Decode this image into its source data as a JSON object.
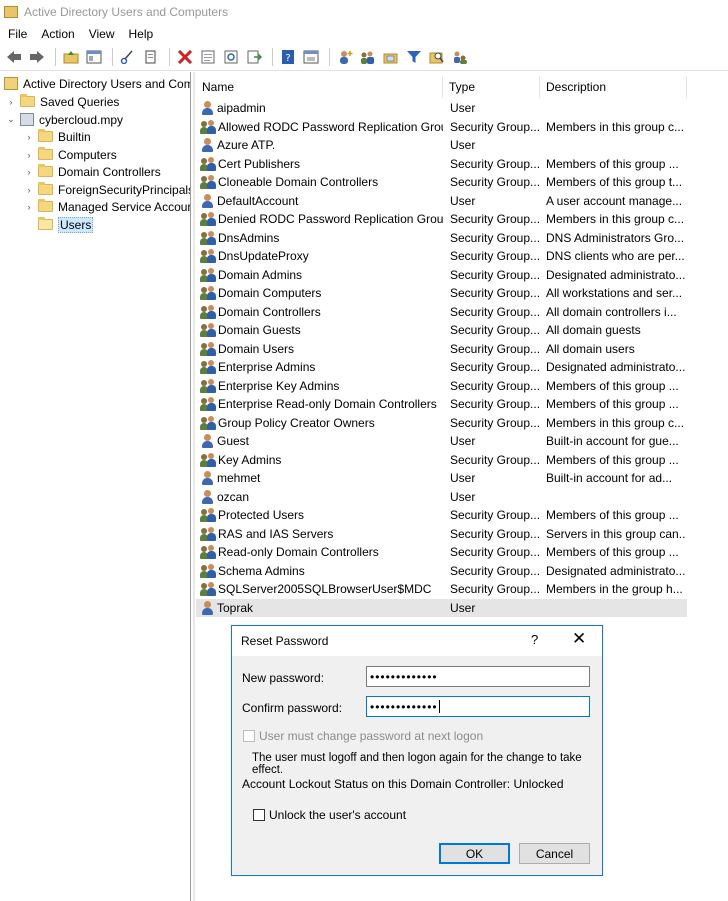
{
  "window": {
    "title": "Active Directory Users and Computers"
  },
  "menu": [
    "File",
    "Action",
    "View",
    "Help"
  ],
  "toolbar": {
    "icons": [
      "back-icon",
      "forward-icon",
      "up-folder-icon",
      "show-hide-tree-icon",
      "cut-icon",
      "copy-icon",
      "delete-icon",
      "properties-icon",
      "refresh-icon",
      "export-list-icon",
      "help-icon",
      "console-icon",
      "new-user-icon",
      "new-group-icon",
      "new-ou-icon",
      "filter-icon",
      "find-icon",
      "add-to-group-icon"
    ]
  },
  "tree": {
    "root": "Active Directory Users and Com",
    "saved_queries": "Saved Queries",
    "domain": "cybercloud.mpy",
    "children": [
      "Builtin",
      "Computers",
      "Domain Controllers",
      "ForeignSecurityPrincipals",
      "Managed Service Accour",
      "Users"
    ],
    "selected": "Users"
  },
  "columns": {
    "name": "Name",
    "type": "Type",
    "description": "Description"
  },
  "rows": [
    {
      "name": "aipadmin",
      "type": "User",
      "description": "",
      "kind": "user"
    },
    {
      "name": "Allowed RODC Password Replication Group",
      "type": "Security Group...",
      "description": "Members in this group c...",
      "kind": "group"
    },
    {
      "name": "Azure ATP.",
      "type": "User",
      "description": "",
      "kind": "user"
    },
    {
      "name": "Cert Publishers",
      "type": "Security Group...",
      "description": "Members of this group ...",
      "kind": "group"
    },
    {
      "name": "Cloneable Domain Controllers",
      "type": "Security Group...",
      "description": "Members of this group t...",
      "kind": "group"
    },
    {
      "name": "DefaultAccount",
      "type": "User",
      "description": "A user account manage...",
      "kind": "user"
    },
    {
      "name": "Denied RODC Password Replication Group",
      "type": "Security Group...",
      "description": "Members in this group c...",
      "kind": "group"
    },
    {
      "name": "DnsAdmins",
      "type": "Security Group...",
      "description": "DNS Administrators Gro...",
      "kind": "group"
    },
    {
      "name": "DnsUpdateProxy",
      "type": "Security Group...",
      "description": "DNS clients who are per...",
      "kind": "group"
    },
    {
      "name": "Domain Admins",
      "type": "Security Group...",
      "description": "Designated administrato...",
      "kind": "group"
    },
    {
      "name": "Domain Computers",
      "type": "Security Group...",
      "description": "All workstations and ser...",
      "kind": "group"
    },
    {
      "name": "Domain Controllers",
      "type": "Security Group...",
      "description": "All domain controllers i...",
      "kind": "group"
    },
    {
      "name": "Domain Guests",
      "type": "Security Group...",
      "description": "All domain guests",
      "kind": "group"
    },
    {
      "name": "Domain Users",
      "type": "Security Group...",
      "description": "All domain users",
      "kind": "group"
    },
    {
      "name": "Enterprise Admins",
      "type": "Security Group...",
      "description": "Designated administrato...",
      "kind": "group"
    },
    {
      "name": "Enterprise Key Admins",
      "type": "Security Group...",
      "description": "Members of this group ...",
      "kind": "group"
    },
    {
      "name": "Enterprise Read-only Domain Controllers",
      "type": "Security Group...",
      "description": "Members of this group ...",
      "kind": "group"
    },
    {
      "name": "Group Policy Creator Owners",
      "type": "Security Group...",
      "description": "Members in this group c...",
      "kind": "group"
    },
    {
      "name": "Guest",
      "type": "User",
      "description": "Built-in account for gue...",
      "kind": "user"
    },
    {
      "name": "Key Admins",
      "type": "Security Group...",
      "description": "Members of this group ...",
      "kind": "group"
    },
    {
      "name": "mehmet",
      "type": "User",
      "description": "Built-in account for ad...",
      "kind": "user"
    },
    {
      "name": "ozcan",
      "type": "User",
      "description": "",
      "kind": "user"
    },
    {
      "name": "Protected Users",
      "type": "Security Group...",
      "description": "Members of this group ...",
      "kind": "group"
    },
    {
      "name": "RAS and IAS Servers",
      "type": "Security Group...",
      "description": "Servers in this group can...",
      "kind": "group"
    },
    {
      "name": "Read-only Domain Controllers",
      "type": "Security Group...",
      "description": "Members of this group ...",
      "kind": "group"
    },
    {
      "name": "Schema Admins",
      "type": "Security Group...",
      "description": "Designated administrato...",
      "kind": "group"
    },
    {
      "name": "SQLServer2005SQLBrowserUser$MDC",
      "type": "Security Group...",
      "description": "Members in the group h...",
      "kind": "group"
    },
    {
      "name": "Toprak",
      "type": "User",
      "description": "",
      "kind": "user",
      "selected": true
    }
  ],
  "dialog": {
    "title": "Reset Password",
    "help": "?",
    "close": "✕",
    "new_password_label": "New password:",
    "new_password_value": "•••••••••••••",
    "confirm_password_label": "Confirm password:",
    "confirm_password_value": "•••••••••••••",
    "must_change_label": "User must change password at next logon",
    "logoff_note": "The user must logoff and then logon again for the change to take effect.",
    "lockout_status": "Account Lockout Status on this Domain Controller: Unlocked",
    "unlock_label": "Unlock the user's account",
    "ok": "OK",
    "cancel": "Cancel"
  }
}
